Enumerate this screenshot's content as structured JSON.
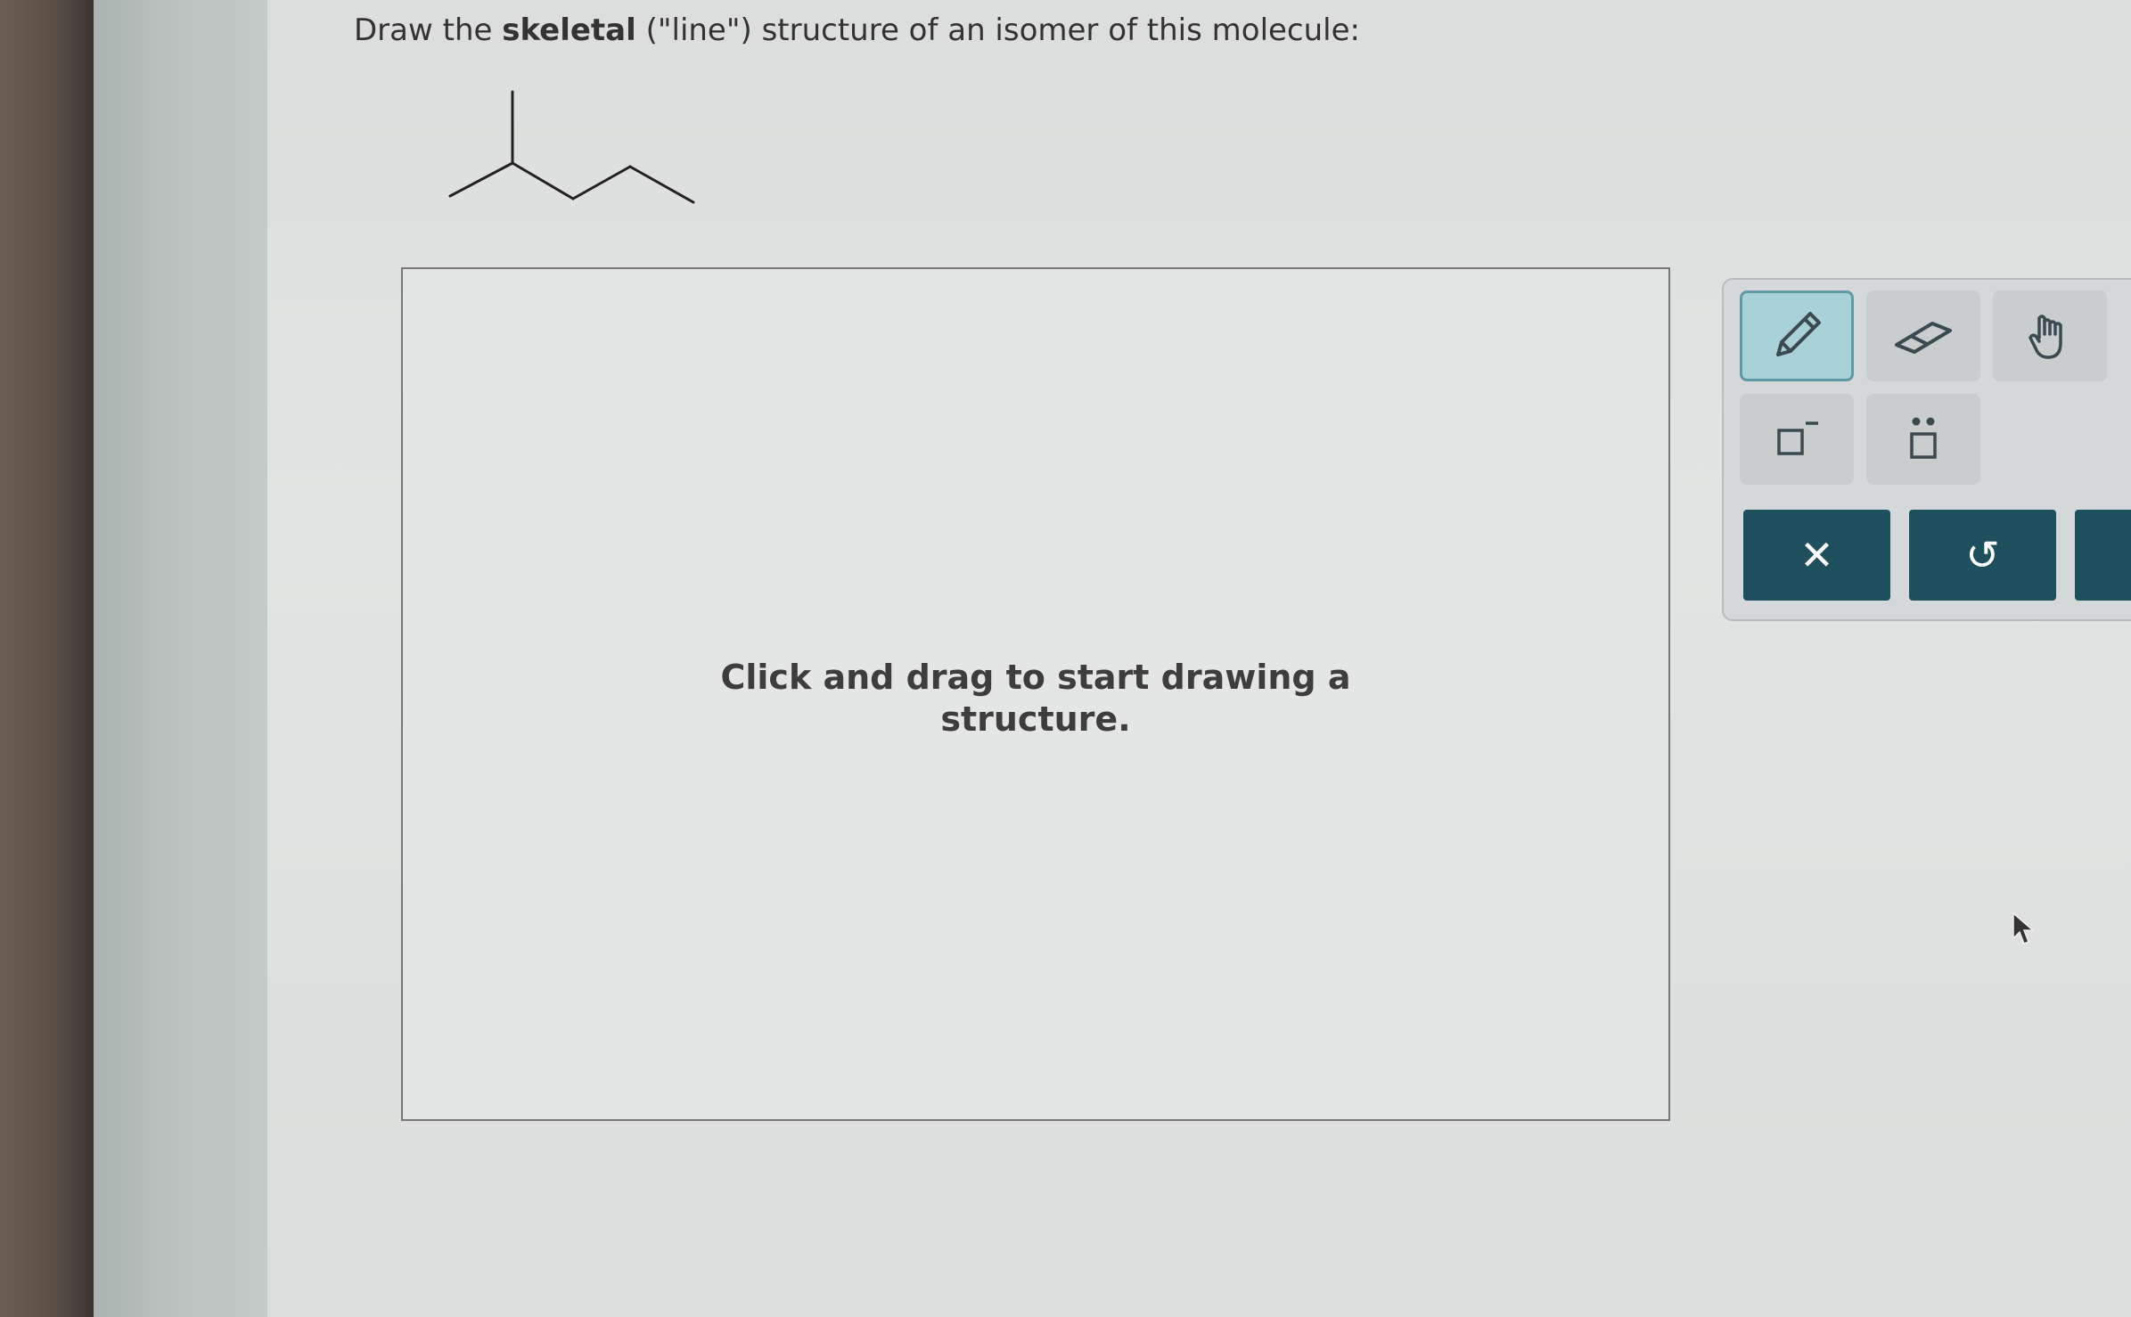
{
  "prompt": {
    "prefix": "Draw the ",
    "bold": "skeletal",
    "suffix": " (\"line\") structure of an isomer of this molecule:"
  },
  "canvas": {
    "hint_line1": "Click and drag to start drawing a",
    "hint_line2": "structure."
  },
  "toolbar": {
    "tools": [
      {
        "icon": "pencil-icon",
        "active": true
      },
      {
        "icon": "eraser-icon",
        "active": false
      },
      {
        "icon": "hand-icon",
        "active": false
      },
      {
        "icon": "charge-icon",
        "active": false
      },
      {
        "icon": "lone-pair-icon",
        "active": false
      }
    ],
    "actions": [
      {
        "icon": "clear-icon",
        "label": "✕"
      },
      {
        "icon": "undo-icon",
        "label": "↺"
      }
    ]
  },
  "colors": {
    "action_bg": "#1e4f5c",
    "active_tool_bg": "#a9d1d8",
    "active_tool_border": "#5f9aa5"
  }
}
